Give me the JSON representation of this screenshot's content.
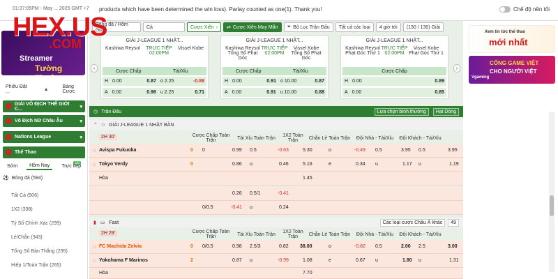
{
  "topbar": {
    "time": "01:37:05PM - May ... 2025 GMT +7",
    "ticker": "products which have been determined the win loss). Parlay counted as one(1). Thank you!",
    "night_mode": "Chế độ nền tối"
  },
  "logo": {
    "text": "HEX.US",
    "sub": ".COM"
  },
  "left": {
    "promo_line1": "Streamer",
    "promo_line2": "Tường Thuật",
    "tabs": [
      "Phiếu Đặt ...",
      "Bảng Cược"
    ],
    "groups": [
      {
        "label": "GIẢI VÔ ĐỊCH THẾ GIỚI C..."
      },
      {
        "label": "Vô Địch Nữ Châu Âu"
      },
      {
        "label": "Nations League"
      },
      {
        "label": "Thể Thao"
      }
    ],
    "subtabs": [
      "Sớm",
      "Hôm Nay",
      "Trực tiếp"
    ],
    "live_count": "18",
    "sport": "Bóng đá (594)",
    "items": [
      "Tất Cả (506)",
      "1X2 (338)",
      "Tỷ Số Chính Xác (299)",
      "Lẻ/Chẵn (343)",
      "Tổng Số Bàn Thắng (295)",
      "Hiệp 1/Toàn Trận (265)"
    ]
  },
  "toolbar": {
    "date": "Bóng đá / Hôm Nay",
    "all": "Cả",
    "parlay": "Cược Xiên",
    "lucky_parlay": "Cược Xiên May Mắn",
    "filter": "Bộ Lọc Trận Đấu",
    "all_types": "Tất cả các loại",
    "hours": "4 giờ tới",
    "count": "(130 / 130) Giải"
  },
  "cards": [
    {
      "league": "GIẢI J-LEAGUE 1 NHẬT...",
      "home": "Kashiwa Reysol",
      "live": "TRỰC TIẾP",
      "time": "02:00PM",
      "away": "Vissel Kobe",
      "h_handicap": "0.00",
      "h_odds": "0.87",
      "h_ou_line": "o 2.25",
      "h_ou_odds": "-0.88",
      "a_handicap": "0.00",
      "a_odds": "0.98",
      "a_ou_line": "u 2.25",
      "a_ou_odds": "0.71"
    },
    {
      "league": "GIẢI J-LEAGUE 1 NHẬT...",
      "home": "Kashiwa Reysol Tổng Số Phạt Góc",
      "live": "TRỰC TIẾP",
      "time": "02:00PM",
      "away": "Vissel Kobe Tổng Số Phạt Góc",
      "h_handicap": "0.00",
      "h_odds": "0.91",
      "h_ou_line": "o 10.00",
      "h_ou_odds": "0.87",
      "a_handicap": "0.00",
      "a_odds": "0.91",
      "a_ou_line": "u 10.00",
      "a_ou_odds": "0.88"
    },
    {
      "league": "GIẢI J-LEAGUE 1 NHẬT...",
      "home": "Kashiwa Reysol Phạt Góc Thứ 1",
      "live": "TRỰC TIẾP",
      "time": "02:00PM",
      "away": "Vissel Kobe Phạt Góc Thứ 1",
      "h_handicap": "0.00",
      "h_odds": "0.89",
      "h_ou_line": "",
      "h_ou_odds": "",
      "a_handicap": "0.00",
      "a_odds": "0.85",
      "a_ou_line": "",
      "a_ou_odds": ""
    }
  ],
  "card_headers": {
    "handicap": "Cược Chấp",
    "ou": "Tài/Xỉu",
    "h": "H",
    "a": "A"
  },
  "section": {
    "title": "Trận Đấu",
    "sort": "Lựa chọn bình thường",
    "lines": "Hai Dòng"
  },
  "league1": {
    "name": "GIẢI J-LEAGUE 1 NHẬT BẢN"
  },
  "columns": [
    "Cược Chấp Toàn Trận",
    "Tài Xỉu Toàn Trận",
    "1X2 Toàn Trận",
    "Chẵn Lẻ Toàn Trận",
    "Đội Nhà - Tài/Xỉu",
    "Đội Khách - Tài/Xỉu"
  ],
  "match1": {
    "tag": "2H 30'",
    "home": "Avispa Fukuoka",
    "away": "Tokyo Verdy",
    "draw": "Hòa",
    "home_score": "0",
    "away_score": "0",
    "r1": [
      "0",
      "0.99",
      "0.5",
      "-0.63",
      "5.30",
      "o",
      "-0.49",
      "0.5",
      "3.95",
      "0.5",
      "3.95"
    ],
    "r2": [
      "",
      "0.86",
      "u",
      "0.46",
      "5.16",
      "e",
      "0.34",
      "u",
      "1.17",
      "u",
      "1.19"
    ],
    "r3": [
      "1.45"
    ],
    "r4": [
      "0.26",
      "0.5/1",
      "-0.41"
    ],
    "r5": [
      "0/0.5",
      "-0.41",
      "u",
      "0.24"
    ]
  },
  "fastbar": {
    "label": "Fast",
    "odds_type": "Các loại cược Châu Á khác",
    "count": "49"
  },
  "match2": {
    "tag": "2H 29'",
    "home": "FC Machida Zelvia",
    "away": "Yokohama F Marinos",
    "draw": "Hòa",
    "home_score": "0",
    "away_score": "2",
    "r1": [
      "0/0.5",
      "0.98",
      "2.5/3",
      "0.82",
      "38.00",
      "o",
      "-0.82",
      "0.5",
      "2.00",
      "2.5",
      "3.00"
    ],
    "r2": [
      "",
      "0.87",
      "u",
      "-0.99",
      "1.08",
      "e",
      "0.67",
      "u",
      "1.80",
      "u",
      "1.31"
    ],
    "r3": [
      "7.70"
    ]
  },
  "ads": {
    "ad1_line1": "Xem tin tức thể thao",
    "ad1_line2": "mới nhất",
    "ad2_line1": "CỔNG GAME VIỆT",
    "ad2_line2": "CHO NGƯỜI VIỆT",
    "ad2_brand": "Vgaming"
  },
  "colors": {
    "green": "#2e7d32",
    "red": "#d8161a",
    "peach": "#fce7df"
  }
}
